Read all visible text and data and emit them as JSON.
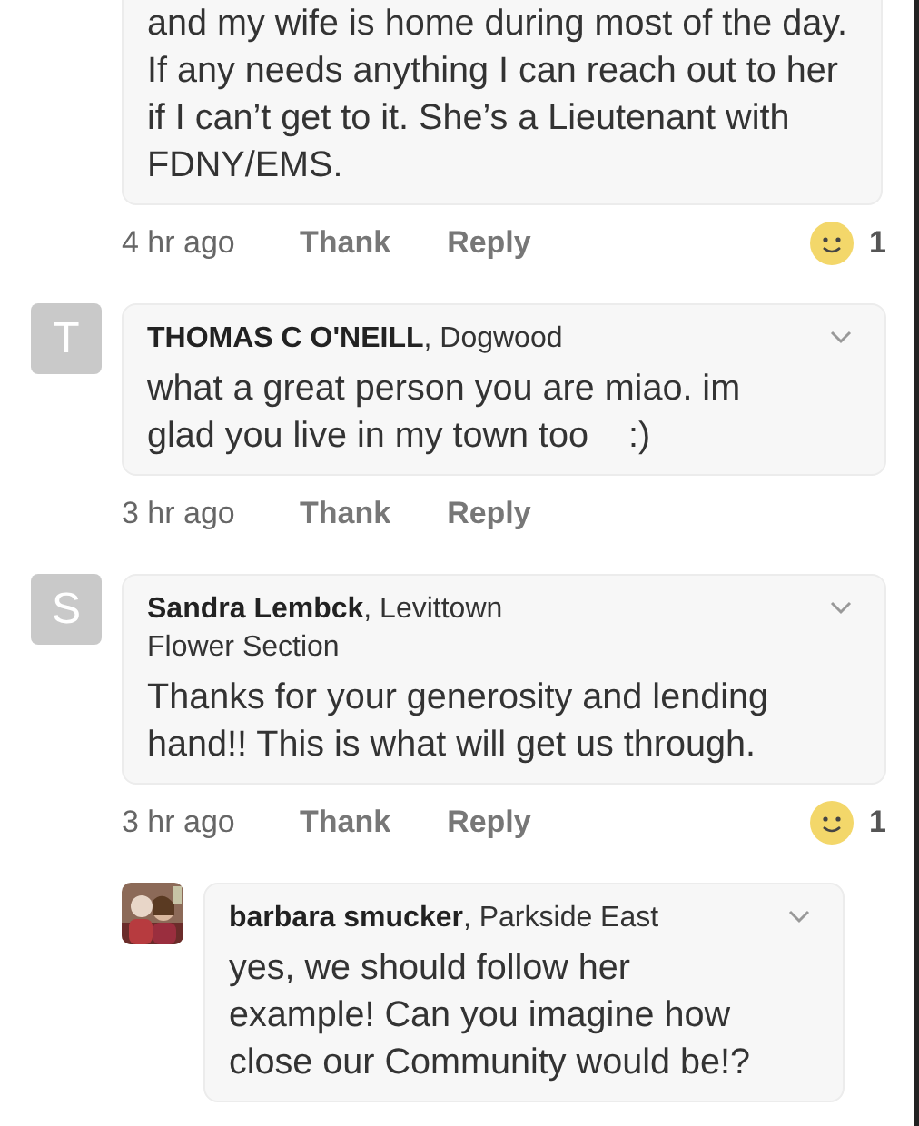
{
  "comments": [
    {
      "kind": "top",
      "body": "and my wife is home during most of the day. If any needs anything I can reach out to her if I can’t get to it. She’s a Lieutenant with FDNY/EMS.",
      "time": "4 hr ago",
      "actions": [
        "Thank",
        "Reply"
      ],
      "reaction_count": "1"
    },
    {
      "kind": "top",
      "avatar": {
        "kind": "letter",
        "letter": "T"
      },
      "header": "**THOMAS C O'NEILL**, Dogwood",
      "menu": true,
      "body": "what a great person you are miao. im glad you live in my town too    :)",
      "time": "3 hr ago",
      "actions": [
        "Thank",
        "Reply"
      ]
    },
    {
      "kind": "top",
      "avatar": {
        "kind": "letter",
        "letter": "S"
      },
      "header": "**Sandra Lembck**, Levittown Flower Section",
      "menu": true,
      "body": "Thanks for your generosity and lending hand!! This is what will get us through.",
      "time": "3 hr ago",
      "actions": [
        "Thank",
        "Reply"
      ],
      "reaction_count": "1"
    },
    {
      "kind": "reply",
      "header": "**barbara smucker**, Parkside East",
      "menu": true,
      "body": "yes, we should follow her example! Can you imagine how close our Community would be!?"
    }
  ]
}
